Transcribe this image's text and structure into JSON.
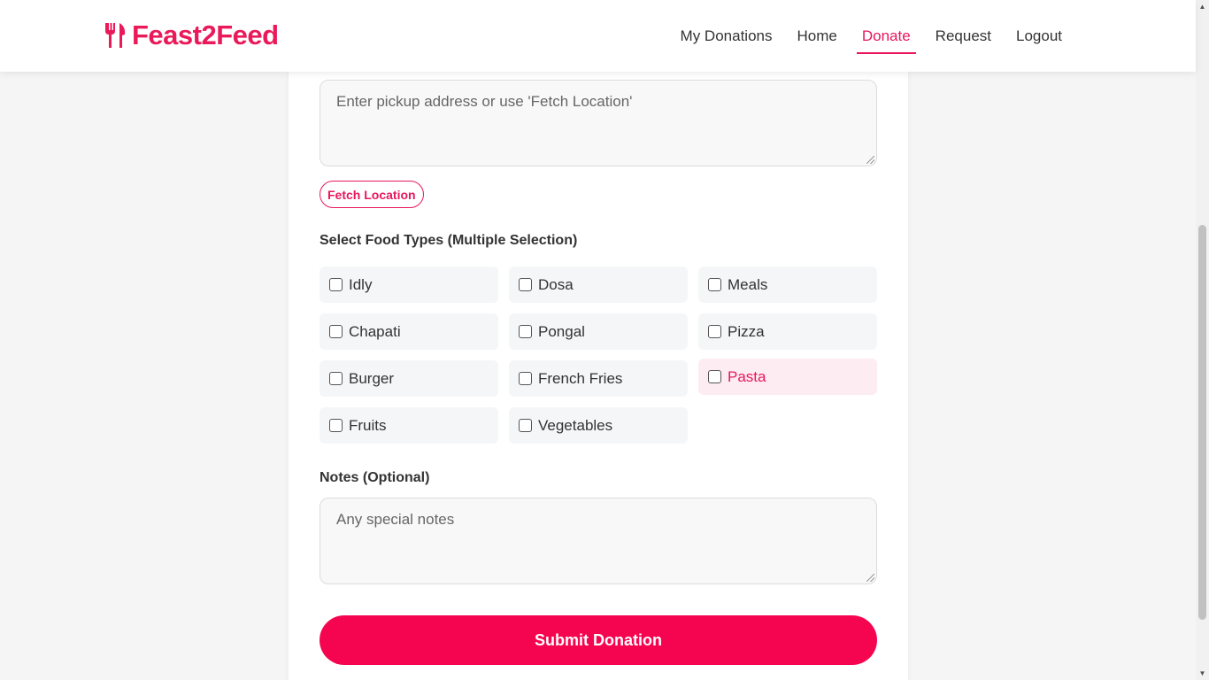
{
  "brand": {
    "name": "Feast2Feed",
    "icon": "fork-knife-icon",
    "color": "#ea1a5a"
  },
  "nav": {
    "items": [
      {
        "label": "My Donations",
        "active": false
      },
      {
        "label": "Home",
        "active": false
      },
      {
        "label": "Donate",
        "active": true
      },
      {
        "label": "Request",
        "active": false
      },
      {
        "label": "Logout",
        "active": false
      }
    ]
  },
  "form": {
    "address": {
      "placeholder": "Enter pickup address or use 'Fetch Location'",
      "value": ""
    },
    "fetch_label": "Fetch Location",
    "food_types_label": "Select Food Types (Multiple Selection)",
    "food_types": [
      {
        "label": "Idly",
        "checked": false
      },
      {
        "label": "Dosa",
        "checked": false
      },
      {
        "label": "Meals",
        "checked": false
      },
      {
        "label": "Chapati",
        "checked": false
      },
      {
        "label": "Pongal",
        "checked": false
      },
      {
        "label": "Pizza",
        "checked": false
      },
      {
        "label": "Burger",
        "checked": false
      },
      {
        "label": "French Fries",
        "checked": false
      },
      {
        "label": "Pasta",
        "checked": false,
        "hovered": true
      },
      {
        "label": "Fruits",
        "checked": false
      },
      {
        "label": "Vegetables",
        "checked": false
      }
    ],
    "notes_label": "Notes (Optional)",
    "notes": {
      "placeholder": "Any special notes",
      "value": ""
    },
    "submit_label": "Submit Donation"
  },
  "colors": {
    "accent": "#e8175d",
    "submit": "#f5054f"
  }
}
